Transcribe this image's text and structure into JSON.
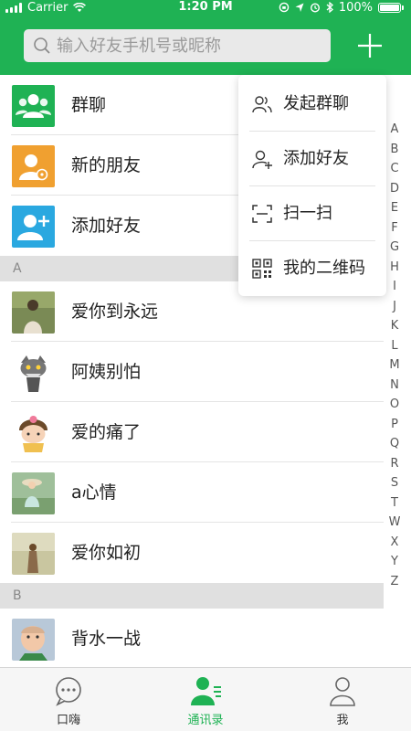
{
  "status_bar": {
    "carrier": "Carrier",
    "time": "1:20 PM",
    "battery": "100%"
  },
  "search": {
    "placeholder": "输入好友手机号或昵称"
  },
  "functions": [
    {
      "label": "群聊",
      "icon": "group-chat-icon",
      "color": "#1fb254"
    },
    {
      "label": "新的朋友",
      "icon": "new-friend-icon",
      "color": "#f0a030"
    },
    {
      "label": "添加好友",
      "icon": "add-friend-icon",
      "color": "#2aa8e0"
    }
  ],
  "sections": [
    {
      "letter": "A",
      "contacts": [
        "爱你到永远",
        "阿姨别怕",
        "爱的痛了",
        "a心情",
        "爱你如初"
      ]
    },
    {
      "letter": "B",
      "contacts": [
        "背水一战"
      ]
    }
  ],
  "alpha_index": [
    "A",
    "B",
    "C",
    "D",
    "E",
    "F",
    "G",
    "H",
    "I",
    "J",
    "K",
    "L",
    "M",
    "N",
    "O",
    "P",
    "Q",
    "R",
    "S",
    "T",
    "W",
    "X",
    "Y",
    "Z"
  ],
  "popup_menu": [
    {
      "label": "发起群聊",
      "icon": "group-chat-icon"
    },
    {
      "label": "添加好友",
      "icon": "add-friend-icon"
    },
    {
      "label": "扫一扫",
      "icon": "scan-icon"
    },
    {
      "label": "我的二维码",
      "icon": "qr-code-icon"
    }
  ],
  "tabs": [
    {
      "label": "口嗨",
      "icon": "chat-bubble-icon",
      "active": false
    },
    {
      "label": "通讯录",
      "icon": "contacts-icon",
      "active": true
    },
    {
      "label": "我",
      "icon": "person-icon",
      "active": false
    }
  ],
  "colors": {
    "brand_green": "#1fb254",
    "section_bg": "#e0e0e0"
  }
}
